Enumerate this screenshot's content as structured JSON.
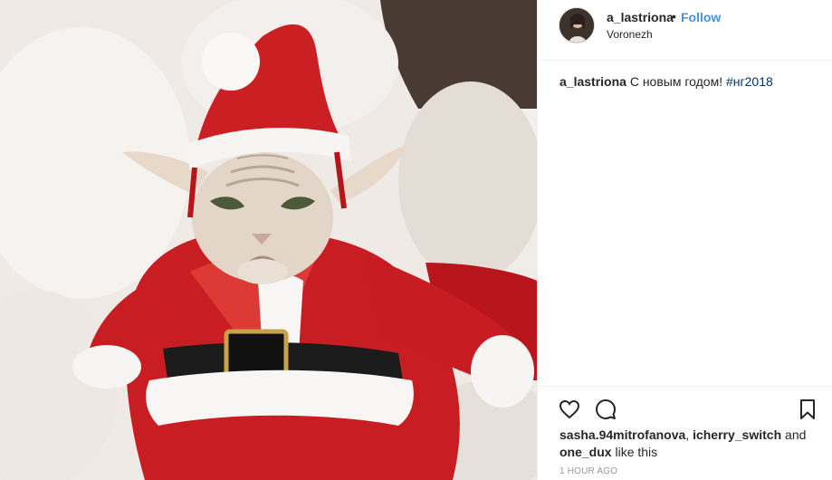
{
  "post": {
    "image": {
      "subject": "sphynx-cat-in-santa-costume"
    },
    "header": {
      "username": "a_lastriona",
      "separator": "•",
      "follow_label": "Follow",
      "location": "Voronezh"
    },
    "caption": {
      "username": "a_lastriona",
      "text": "С новым годом!",
      "hashtag": "#нг2018"
    },
    "actions": {
      "like_icon": "heart-outline-icon",
      "comment_icon": "speech-bubble-icon",
      "save_icon": "bookmark-outline-icon"
    },
    "likes": {
      "user1": "sasha.94mitrofanova",
      "sep1": ",",
      "user2": "icherry_switch",
      "and": "and",
      "user3": "one_dux",
      "suffix": "like this"
    },
    "timestamp": "1 HOUR AGO"
  },
  "colors": {
    "link_blue": "#3897f0",
    "hashtag": "#003569",
    "text": "#262626",
    "muted": "#999999",
    "border": "#efefef"
  }
}
